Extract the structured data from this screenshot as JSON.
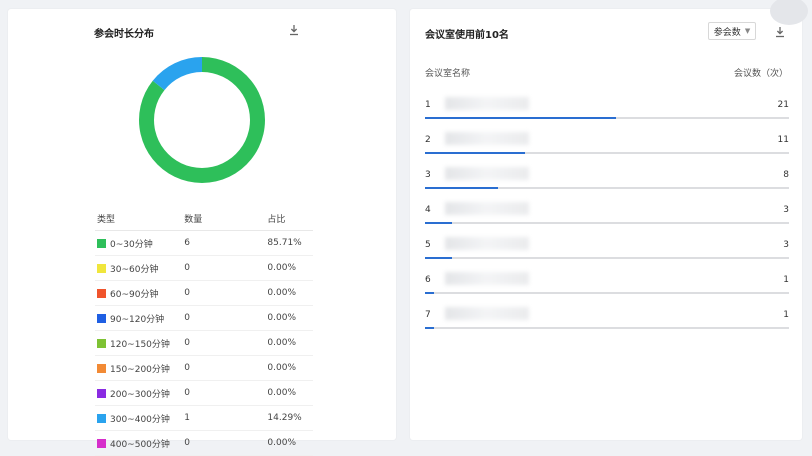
{
  "left_panel": {
    "title": "参会时长分布",
    "donut": [
      {
        "label": "0-30分钟",
        "value": 6,
        "color": "#2ebf5a"
      },
      {
        "label": "300-400分钟",
        "value": 1,
        "color": "#2aa3ee"
      }
    ],
    "table": {
      "headers": [
        "类型",
        "数量",
        "占比"
      ],
      "rows": [
        {
          "type": "0~30分钟",
          "count": "6",
          "percent": "85.71%",
          "color": "#2ebf5a"
        },
        {
          "type": "30~60分钟",
          "count": "0",
          "percent": "0.00%",
          "color": "#f0e63c"
        },
        {
          "type": "60~90分钟",
          "count": "0",
          "percent": "0.00%",
          "color": "#f0542c"
        },
        {
          "type": "90~120分钟",
          "count": "0",
          "percent": "0.00%",
          "color": "#1f5fe3"
        },
        {
          "type": "120~150分钟",
          "count": "0",
          "percent": "0.00%",
          "color": "#7ec234"
        },
        {
          "type": "150~200分钟",
          "count": "0",
          "percent": "0.00%",
          "color": "#f28a35"
        },
        {
          "type": "200~300分钟",
          "count": "0",
          "percent": "0.00%",
          "color": "#8a2be2"
        },
        {
          "type": "300~400分钟",
          "count": "1",
          "percent": "14.29%",
          "color": "#2aa3ee"
        },
        {
          "type": "400~500分钟",
          "count": "0",
          "percent": "0.00%",
          "color": "#d62ecb"
        }
      ]
    }
  },
  "right_panel": {
    "title": "会议室使用前10名",
    "select_value": "参会数",
    "headers": {
      "name": "会议室名称",
      "value": "会议数（次）"
    },
    "bar_max": 40,
    "items": [
      {
        "rank": "1",
        "value": 21
      },
      {
        "rank": "2",
        "value": 11
      },
      {
        "rank": "3",
        "value": 8
      },
      {
        "rank": "4",
        "value": 3
      },
      {
        "rank": "5",
        "value": 3
      },
      {
        "rank": "6",
        "value": 1
      },
      {
        "rank": "7",
        "value": 1
      }
    ]
  }
}
